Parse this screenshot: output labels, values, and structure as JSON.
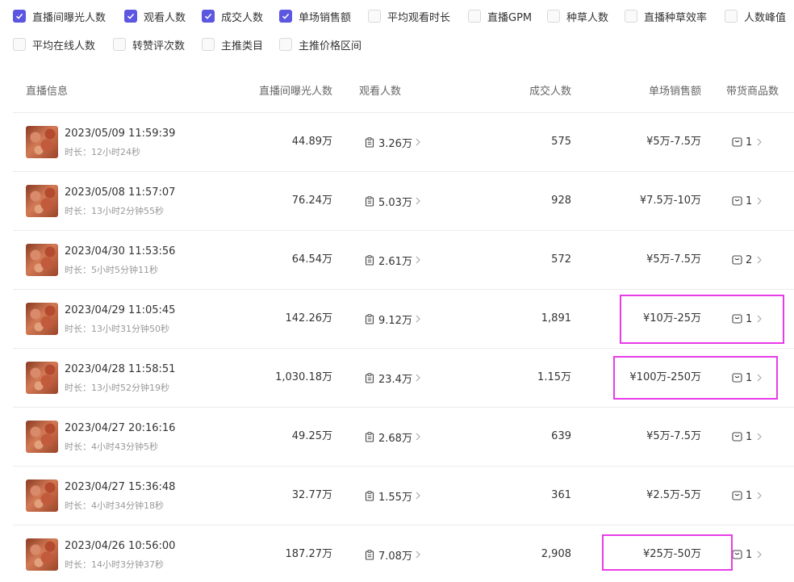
{
  "filters": [
    {
      "label": "直播间曝光人数",
      "checked": true
    },
    {
      "label": "观看人数",
      "checked": true
    },
    {
      "label": "成交人数",
      "checked": true
    },
    {
      "label": "单场销售额",
      "checked": true
    },
    {
      "label": "平均观看时长",
      "checked": false
    },
    {
      "label": "直播GPM",
      "checked": false
    },
    {
      "label": "种草人数",
      "checked": false
    },
    {
      "label": "直播种草效率",
      "checked": false
    },
    {
      "label": "人数峰值",
      "checked": false
    },
    {
      "label": "平均在线人数",
      "checked": false
    },
    {
      "label": "转赞评次数",
      "checked": false
    },
    {
      "label": "主推类目",
      "checked": false
    },
    {
      "label": "主推价格区间",
      "checked": false
    }
  ],
  "table": {
    "headers": {
      "info": "直播信息",
      "exposure": "直播间曝光人数",
      "viewers": "观看人数",
      "deals": "成交人数",
      "sales": "单场销售额",
      "goods": "带货商品数"
    },
    "rows": [
      {
        "datetime": "2023/05/09 11:59:39",
        "duration": "时长：12小时24秒",
        "exposure": "44.89万",
        "viewers": "3.26万",
        "deals": "575",
        "sales": "¥5万-7.5万",
        "goods": "1"
      },
      {
        "datetime": "2023/05/08 11:57:07",
        "duration": "时长：13小时2分钟55秒",
        "exposure": "76.24万",
        "viewers": "5.03万",
        "deals": "928",
        "sales": "¥7.5万-10万",
        "goods": "1"
      },
      {
        "datetime": "2023/04/30 11:53:56",
        "duration": "时长：5小时5分钟11秒",
        "exposure": "64.54万",
        "viewers": "2.61万",
        "deals": "572",
        "sales": "¥5万-7.5万",
        "goods": "2"
      },
      {
        "datetime": "2023/04/29 11:05:45",
        "duration": "时长：13小时31分钟50秒",
        "exposure": "142.26万",
        "viewers": "9.12万",
        "deals": "1,891",
        "sales": "¥10万-25万",
        "goods": "1"
      },
      {
        "datetime": "2023/04/28 11:58:51",
        "duration": "时长：13小时52分钟19秒",
        "exposure": "1,030.18万",
        "viewers": "23.4万",
        "deals": "1.15万",
        "sales": "¥100万-250万",
        "goods": "1"
      },
      {
        "datetime": "2023/04/27 20:16:16",
        "duration": "时长：4小时43分钟5秒",
        "exposure": "49.25万",
        "viewers": "2.68万",
        "deals": "639",
        "sales": "¥5万-7.5万",
        "goods": "1"
      },
      {
        "datetime": "2023/04/27 15:36:48",
        "duration": "时长：4小时34分钟18秒",
        "exposure": "32.77万",
        "viewers": "1.55万",
        "deals": "361",
        "sales": "¥2.5万-5万",
        "goods": "1"
      },
      {
        "datetime": "2023/04/26 10:56:00",
        "duration": "时长：14小时3分钟37秒",
        "exposure": "187.27万",
        "viewers": "7.08万",
        "deals": "2,908",
        "sales": "¥25万-50万",
        "goods": "1"
      }
    ]
  },
  "colors": {
    "accent": "#5b57e0",
    "highlight": "#e83ce8"
  },
  "icons": {
    "checkbox": "check-icon",
    "viewers": "clipboard-icon",
    "goods": "shopping-bag-icon",
    "more": "chevron-right-icon"
  }
}
